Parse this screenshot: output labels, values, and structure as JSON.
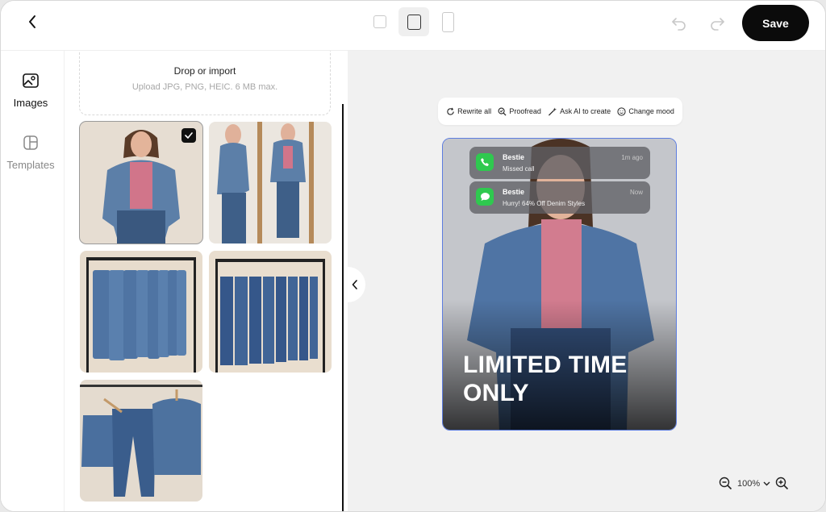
{
  "header": {
    "back_label": "Back",
    "ratio_options": [
      "square",
      "portrait-4x5",
      "story-9x16"
    ],
    "selected_ratio": "portrait-4x5",
    "save_label": "Save"
  },
  "rail": {
    "items": [
      {
        "label": "Images",
        "icon": "image-icon",
        "active": true
      },
      {
        "label": "Templates",
        "icon": "template-icon",
        "active": false
      }
    ]
  },
  "panel": {
    "dropzone_title": "Drop or import",
    "dropzone_hint": "Upload JPG, PNG, HEIC. 6 MB max.",
    "thumbnails": [
      {
        "name": "woman-denim-jacket",
        "selected": true
      },
      {
        "name": "woman-mirror-denim",
        "selected": false
      },
      {
        "name": "rack-denim-jackets",
        "selected": false
      },
      {
        "name": "rack-denim-jeans",
        "selected": false
      },
      {
        "name": "denim-set-hangers",
        "selected": false
      }
    ]
  },
  "toolbar": {
    "rewrite_label": "Rewrite all",
    "proofread_label": "Proofread",
    "ask_ai_label": "Ask AI to create",
    "mood_label": "Change mood"
  },
  "ad": {
    "notifications": [
      {
        "sender": "Bestie",
        "message": "Missed call",
        "time": "1m ago",
        "app": "phone-app-icon"
      },
      {
        "sender": "Bestie",
        "message": "Hurry! 64% Off Denim Styles",
        "time": "Now",
        "app": "messages-app-icon"
      }
    ],
    "headline_line1": "LIMITED TIME",
    "headline_line2": "ONLY",
    "border_color": "#5d7de0"
  },
  "zoom": {
    "level": "100%"
  },
  "colors": {
    "accent": "#0b0b0b",
    "notification_green": "#2fc94f"
  }
}
